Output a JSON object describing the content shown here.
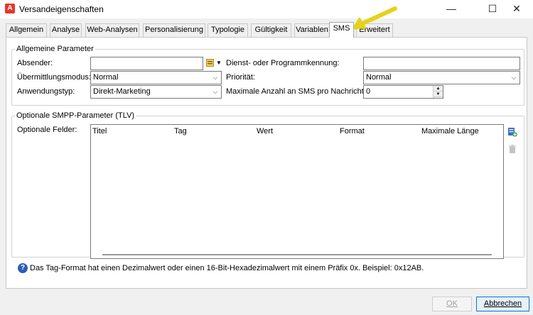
{
  "window": {
    "title": "Versandeigenschaften",
    "app_icon": "adobe-campaign-icon",
    "controls": {
      "minimize": "—",
      "maximize": "☐",
      "close": "✕"
    }
  },
  "tabs": [
    {
      "label": "Allgemein",
      "active": false
    },
    {
      "label": "Analyse",
      "active": false
    },
    {
      "label": "Web-Analysen",
      "active": false
    },
    {
      "label": "Personalisierung",
      "active": false
    },
    {
      "label": "Typologie",
      "active": false
    },
    {
      "label": "Gültigkeit",
      "active": false
    },
    {
      "label": "Variablen",
      "active": false
    },
    {
      "label": "SMS",
      "active": true
    },
    {
      "label": "Erweitert",
      "active": false
    }
  ],
  "general": {
    "legend": "Allgemeine Parameter",
    "sender_label": "Absender:",
    "sender_value": "",
    "transmission_label": "Übermittlungsmodus:",
    "transmission_value": "Normal",
    "application_label": "Anwendungstyp:",
    "application_value": "Direkt-Marketing",
    "service_label": "Dienst- oder Programmkennung:",
    "service_value": "",
    "priority_label": "Priorität:",
    "priority_value": "Normal",
    "max_sms_label": "Maximale Anzahl an SMS pro Nachricht:",
    "max_sms_value": "0"
  },
  "smpp": {
    "legend": "Optionale SMPP-Parameter (TLV)",
    "fields_label": "Optionale Felder:",
    "columns": [
      "Titel",
      "Tag",
      "Wert",
      "Format",
      "Maximale Länge"
    ],
    "rows": []
  },
  "info_text": "Das Tag-Format hat einen Dezimalwert oder einen 16-Bit-Hexadezimalwert mit einem Präfix 0x. Beispiel: 0x12AB.",
  "buttons": {
    "ok": "OK",
    "cancel": "Abbrechen"
  },
  "colors": {
    "annotation_arrow": "#e6d21a",
    "accent": "#0078d7"
  }
}
